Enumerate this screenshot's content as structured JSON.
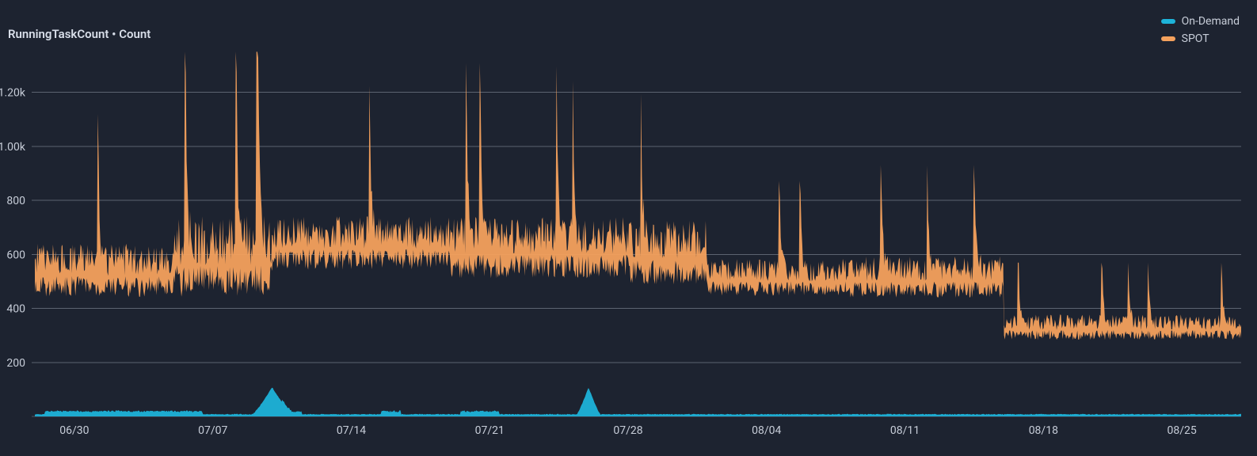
{
  "title": "RunningTaskCount • Count",
  "legend": {
    "items": {
      "onDemand": {
        "label": "On-Demand",
        "color": "#1db3d9"
      },
      "spot": {
        "label": "SPOT",
        "color": "#f4a15d"
      }
    }
  },
  "axes": {
    "y": {
      "ticks": [
        "200",
        "400",
        "600",
        "800",
        "1.00k",
        "1.20k"
      ],
      "tick_values": [
        200,
        400,
        600,
        800,
        1000,
        1200
      ],
      "range": [
        0,
        1360
      ]
    },
    "x": {
      "ticks": [
        "06/30",
        "07/07",
        "07/14",
        "07/21",
        "07/28",
        "08/04",
        "08/11",
        "08/18",
        "08/25"
      ]
    }
  },
  "chart_data": {
    "type": "area",
    "title": "RunningTaskCount • Count",
    "ylabel": "Count",
    "ylim": [
      0,
      1360
    ],
    "x_dates": [
      "06/30",
      "07/07",
      "07/14",
      "07/21",
      "07/28",
      "08/04",
      "08/11",
      "08/18",
      "08/25"
    ],
    "series": [
      {
        "name": "SPOT",
        "color": "#f4a15d",
        "segments": [
          {
            "date_start": "06/28",
            "date_end": "07/05",
            "low": 350,
            "high": 1040,
            "typical": 520
          },
          {
            "date_start": "07/05",
            "date_end": "07/10",
            "low": 300,
            "high": 1350,
            "typical": 560
          },
          {
            "date_start": "07/10",
            "date_end": "07/19",
            "low": 430,
            "high": 1120,
            "typical": 620
          },
          {
            "date_start": "07/19",
            "date_end": "07/28",
            "low": 400,
            "high": 1190,
            "typical": 600
          },
          {
            "date_start": "07/28",
            "date_end": "08/01",
            "low": 330,
            "high": 1160,
            "typical": 580
          },
          {
            "date_start": "08/01",
            "date_end": "08/08",
            "low": 320,
            "high": 800,
            "typical": 500
          },
          {
            "date_start": "08/08",
            "date_end": "08/16",
            "low": 310,
            "high": 850,
            "typical": 500
          },
          {
            "date_start": "08/16",
            "date_end": "08/28",
            "low": 190,
            "high": 520,
            "typical": 320
          }
        ]
      },
      {
        "name": "On-Demand",
        "color": "#1db3d9",
        "baseline": 8,
        "spikes": [
          {
            "date": "07/10",
            "peak": 100,
            "width_days": 1.0
          },
          {
            "date": "07/26",
            "peak": 100,
            "width_days": 0.6
          }
        ],
        "small_bumps_dates": [
          "06/29",
          "06/30",
          "07/01",
          "07/02",
          "07/03",
          "07/04",
          "07/05",
          "07/06",
          "07/11",
          "07/16",
          "07/20",
          "07/21"
        ]
      }
    ]
  }
}
